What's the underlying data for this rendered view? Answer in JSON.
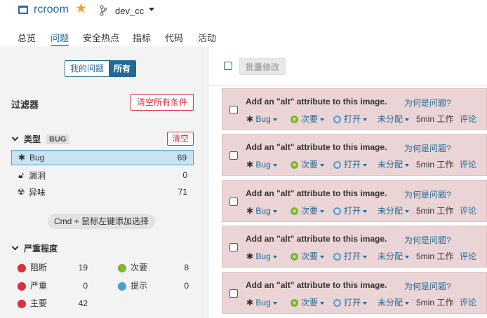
{
  "header": {
    "project_name": "rcroom",
    "branch": "dev_cc",
    "icons": {
      "project": "project-icon",
      "favorite": "star-icon",
      "branch": "branch-icon"
    },
    "accent_color": "#236a97",
    "favorite_color": "#f0a030"
  },
  "nav": {
    "tabs": [
      {
        "label": "总览"
      },
      {
        "label": "问题",
        "active": true
      },
      {
        "label": "安全热点"
      },
      {
        "label": "指标"
      },
      {
        "label": "代码"
      },
      {
        "label": "活动"
      }
    ]
  },
  "sidebar": {
    "toggle": {
      "mine": "我的问题",
      "all": "所有",
      "selected": "all"
    },
    "filter_title": "过滤器",
    "clear_all": "清空所有条件",
    "type_facet": {
      "title": "类型",
      "badge": "BUG",
      "clear": "清空",
      "items": [
        {
          "icon": "bug-icon",
          "label": "Bug",
          "count": "69",
          "selected": true
        },
        {
          "icon": "lock-icon",
          "label": "漏洞",
          "count": "0"
        },
        {
          "icon": "radiation-icon",
          "label": "异味",
          "count": "71"
        }
      ]
    },
    "hint": "Cmd + 鼠标左键添加选择",
    "severity_facet": {
      "title": "严重程度",
      "items": [
        {
          "icon": "blocker-icon",
          "label": "阻断",
          "count": "19",
          "color": "#d4333f"
        },
        {
          "icon": "minor-icon",
          "label": "次要",
          "count": "8",
          "color": "#7fb82a"
        },
        {
          "icon": "critical-icon",
          "label": "严重",
          "count": "0",
          "color": "#d4333f"
        },
        {
          "icon": "info-icon",
          "label": "提示",
          "count": "0",
          "color": "#4b9fd5"
        },
        {
          "icon": "major-icon",
          "label": "主要",
          "count": "42",
          "color": "#d4333f"
        }
      ]
    }
  },
  "main": {
    "bulk_change": "批量修改",
    "issue_color": "#ebd4d5",
    "issues": [
      {
        "message": "Add an \"alt\" attribute to this image.",
        "why": "为何是问题?",
        "type": "Bug",
        "severity": "次要",
        "status": "打开",
        "assignee": "未分配",
        "effort": "5min 工作",
        "comment": "评论"
      },
      {
        "message": "Add an \"alt\" attribute to this image.",
        "why": "为何是问题?",
        "type": "Bug",
        "severity": "次要",
        "status": "打开",
        "assignee": "未分配",
        "effort": "5min 工作",
        "comment": "评论"
      },
      {
        "message": "Add an \"alt\" attribute to this image.",
        "why": "为何是问题?",
        "type": "Bug",
        "severity": "次要",
        "status": "打开",
        "assignee": "未分配",
        "effort": "5min 工作",
        "comment": "评论"
      },
      {
        "message": "Add an \"alt\" attribute to this image.",
        "why": "为何是问题?",
        "type": "Bug",
        "severity": "次要",
        "status": "打开",
        "assignee": "未分配",
        "effort": "5min 工作",
        "comment": "评论"
      },
      {
        "message": "Add an \"alt\" attribute to this image.",
        "why": "为何是问题?",
        "type": "Bug",
        "severity": "次要",
        "status": "打开",
        "assignee": "未分配",
        "effort": "5min 工作",
        "comment": "评论"
      }
    ]
  }
}
